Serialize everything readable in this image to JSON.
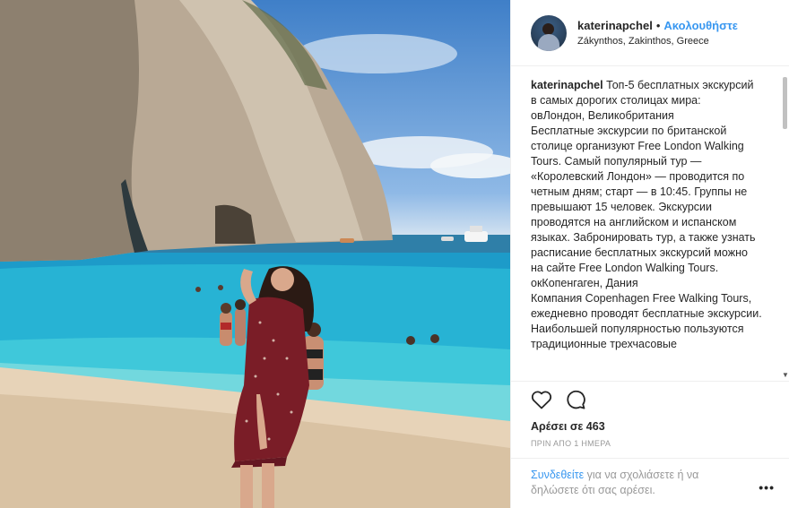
{
  "post": {
    "photo": {
      "icon": "beach-photo"
    },
    "header": {
      "username": "katerinapchel",
      "separator": "•",
      "follow_label": "Ακολουθήστε",
      "location": "Zákynthos, Zakinthos, Greece"
    },
    "caption": {
      "username": "katerinapchel",
      "text": " Топ-5 бесплатных экскурсий в самых дорогих столицах мира:\nовЛондон, Великобритания\nБесплатные экскурсии по британской столице организуют Free London Walking Tours. Самый популярный тур — «Королевский Лондон» — проводится по четным дням; старт — в 10:45. Группы не превышают 15 человек. Экскурсии проводятся на английском и испанском языках. Забронировать тур, а также узнать расписание бесплатных экскурсий можно на сайте Free London Walking Tours.\nокКопенгаген, Дания\nКомпания Copenhagen Free Walking Tours, ежедневно проводят бесплатные экскурсии. Наибольшей популярностью пользуются традиционные трехчасовые"
    },
    "actions": {
      "like_icon": "heart-icon",
      "comment_icon": "comment-icon"
    },
    "likes_text": "Αρέσει σε 463",
    "timestamp": "ΠΡΙΝ ΑΠΟ 1 ΗΜΕΡΑ",
    "comment_prompt": {
      "login_label": "Συνδεθείτε",
      "rest": " για να σχολιάσετε ή να δηλώσετε ότι σας αρέσει."
    },
    "more_label": "•••"
  }
}
